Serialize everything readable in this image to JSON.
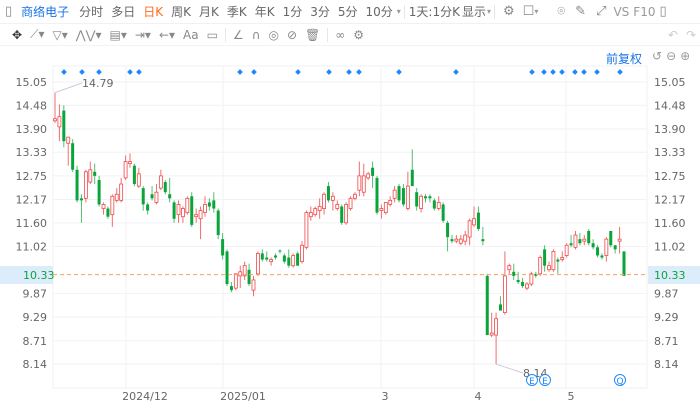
{
  "toolbar": {
    "stock_name": "商络电子",
    "periods": [
      "分时",
      "多日",
      "日K",
      "周K",
      "月K",
      "季K",
      "年K",
      "1分",
      "3分",
      "5分",
      "10分"
    ],
    "active_period": "日K",
    "range_label": "1天:1分K",
    "display_label": "显示",
    "vs_label": "VS",
    "f10_label": "F10",
    "icons": [
      "settings-icon",
      "layout-icon",
      "camera-icon",
      "pencil-icon",
      "fullscreen-icon",
      "panel-icon"
    ]
  },
  "drawing_tools": {
    "text_tool_label": "Aa",
    "icons": [
      "move-icon",
      "line-icon",
      "polygon-icon",
      "wave-icon",
      "fib-icon",
      "measure-icon",
      "arrow-icon",
      "text-icon",
      "comment-icon",
      "angle-icon",
      "magnet-icon",
      "eye-icon",
      "hide-icon",
      "trash-icon",
      "link-icon",
      "settings-icon",
      "undo-icon",
      "redo-icon"
    ]
  },
  "chart_header": {
    "adjust_label": "前复权",
    "icons": [
      "reset-icon",
      "zoom-out-icon",
      "zoom-in-icon"
    ]
  },
  "chart_data": {
    "type": "candlestick",
    "y_ticks": [
      "15.05",
      "14.48",
      "13.90",
      "13.33",
      "12.75",
      "12.17",
      "11.60",
      "11.02",
      "9.87",
      "9.29",
      "8.71",
      "8.14"
    ],
    "ylim": [
      7.6,
      15.4
    ],
    "x_ticks": [
      "2024/12",
      "2025/01",
      "3",
      "4",
      "5"
    ],
    "current_price": "10.33",
    "high_label": "14.79",
    "low_label": "8.14",
    "colors": {
      "up": "#f0494a",
      "down": "#0aa53a",
      "current": "#f6a05c",
      "marker": "#1e88ff"
    },
    "ohlc": [
      [
        14.1,
        14.79,
        14.05,
        14.15
      ],
      [
        13.95,
        14.5,
        13.6,
        14.2
      ],
      [
        14.35,
        14.48,
        13.45,
        13.6
      ],
      [
        13.55,
        13.7,
        13.0,
        13.7
      ],
      [
        13.55,
        13.65,
        12.85,
        12.9
      ],
      [
        12.9,
        13.0,
        12.1,
        12.15
      ],
      [
        12.2,
        12.3,
        11.6,
        12.15
      ],
      [
        12.2,
        12.9,
        12.1,
        12.85
      ],
      [
        12.6,
        13.1,
        12.55,
        12.9
      ],
      [
        12.85,
        13.05,
        12.55,
        12.75
      ],
      [
        12.65,
        12.75,
        12.0,
        12.05
      ],
      [
        11.95,
        12.1,
        11.8,
        12.05
      ],
      [
        11.95,
        12.0,
        11.7,
        11.75
      ],
      [
        11.8,
        12.3,
        11.5,
        12.25
      ],
      [
        12.15,
        12.45,
        12.1,
        12.3
      ],
      [
        12.15,
        12.7,
        12.1,
        12.55
      ],
      [
        12.7,
        13.25,
        12.65,
        13.1
      ],
      [
        13.05,
        13.3,
        12.95,
        13.1
      ],
      [
        13.0,
        13.05,
        12.5,
        12.55
      ],
      [
        12.5,
        12.95,
        12.45,
        12.8
      ],
      [
        12.45,
        12.5,
        11.9,
        12.05
      ],
      [
        12.05,
        12.1,
        11.8,
        11.9
      ],
      [
        12.3,
        12.5,
        12.15,
        12.2
      ],
      [
        12.1,
        12.55,
        12.05,
        12.35
      ],
      [
        12.45,
        12.9,
        12.4,
        12.75
      ],
      [
        12.6,
        12.65,
        12.3,
        12.35
      ],
      [
        12.3,
        12.7,
        12.1,
        12.2
      ],
      [
        12.1,
        12.15,
        11.6,
        11.7
      ],
      [
        11.8,
        12.15,
        11.6,
        12.05
      ],
      [
        11.75,
        12.0,
        11.6,
        11.95
      ],
      [
        11.85,
        12.25,
        11.8,
        12.2
      ],
      [
        12.25,
        12.35,
        11.5,
        11.55
      ],
      [
        11.75,
        11.95,
        11.6,
        11.8
      ],
      [
        11.7,
        12.0,
        11.2,
        11.9
      ],
      [
        11.85,
        12.25,
        11.75,
        12.05
      ],
      [
        12.1,
        12.2,
        11.9,
        12.0
      ],
      [
        12.15,
        12.35,
        11.85,
        11.95
      ],
      [
        11.9,
        11.95,
        11.2,
        11.3
      ],
      [
        11.2,
        11.35,
        10.7,
        10.8
      ],
      [
        10.9,
        10.95,
        10.05,
        10.1
      ],
      [
        10.05,
        10.15,
        9.9,
        9.95
      ],
      [
        10.0,
        10.35,
        9.95,
        10.35
      ],
      [
        10.3,
        10.55,
        10.0,
        10.4
      ],
      [
        10.3,
        10.65,
        10.2,
        10.55
      ],
      [
        10.45,
        10.6,
        10.05,
        10.1
      ],
      [
        9.95,
        10.3,
        9.8,
        10.2
      ],
      [
        10.35,
        10.9,
        10.3,
        10.85
      ],
      [
        10.85,
        10.95,
        10.65,
        10.7
      ],
      [
        10.75,
        10.9,
        10.65,
        10.7
      ],
      [
        10.65,
        10.75,
        10.55,
        10.7
      ],
      [
        10.8,
        10.85,
        10.7,
        10.75
      ],
      [
        10.92,
        10.95,
        10.85,
        10.9
      ],
      [
        10.8,
        10.85,
        10.6,
        10.65
      ],
      [
        10.75,
        10.95,
        10.5,
        10.55
      ],
      [
        10.55,
        10.85,
        10.5,
        10.8
      ],
      [
        10.85,
        10.9,
        10.55,
        10.55
      ],
      [
        10.65,
        11.15,
        10.6,
        11.05
      ],
      [
        11.0,
        11.9,
        10.95,
        11.85
      ],
      [
        11.75,
        12.0,
        11.65,
        11.85
      ],
      [
        11.8,
        12.0,
        11.75,
        11.95
      ],
      [
        11.9,
        12.2,
        11.7,
        12.0
      ],
      [
        11.95,
        12.35,
        11.8,
        12.3
      ],
      [
        12.5,
        12.6,
        12.1,
        12.15
      ],
      [
        12.15,
        12.35,
        11.9,
        12.25
      ],
      [
        11.95,
        12.15,
        11.9,
        12.05
      ],
      [
        12.0,
        12.05,
        11.55,
        11.6
      ],
      [
        11.6,
        12.1,
        11.55,
        12.05
      ],
      [
        11.95,
        12.25,
        11.9,
        12.2
      ],
      [
        12.2,
        12.35,
        12.15,
        12.3
      ],
      [
        12.4,
        13.1,
        12.25,
        12.75
      ],
      [
        12.35,
        13.05,
        12.25,
        12.75
      ],
      [
        12.7,
        12.85,
        12.65,
        12.8
      ],
      [
        12.95,
        13.1,
        12.45,
        12.75
      ],
      [
        12.7,
        12.75,
        11.8,
        11.85
      ],
      [
        11.9,
        12.05,
        11.7,
        11.95
      ],
      [
        11.85,
        12.1,
        11.8,
        12.1
      ],
      [
        12.05,
        12.25,
        12.0,
        12.15
      ],
      [
        12.2,
        12.5,
        12.1,
        12.4
      ],
      [
        12.5,
        12.55,
        12.1,
        12.15
      ],
      [
        12.45,
        12.55,
        12.0,
        12.05
      ],
      [
        11.95,
        12.85,
        11.9,
        12.5
      ],
      [
        12.9,
        13.4,
        12.5,
        12.5
      ],
      [
        12.35,
        12.45,
        11.9,
        12.0
      ],
      [
        11.95,
        12.3,
        11.85,
        12.25
      ],
      [
        12.25,
        12.3,
        12.1,
        12.2
      ],
      [
        12.25,
        12.3,
        12.1,
        12.2
      ],
      [
        12.15,
        12.2,
        11.9,
        11.95
      ],
      [
        11.95,
        12.25,
        11.9,
        12.1
      ],
      [
        12.05,
        12.1,
        11.6,
        11.65
      ],
      [
        11.6,
        11.65,
        10.9,
        11.25
      ],
      [
        11.2,
        11.3,
        11.1,
        11.15
      ],
      [
        11.15,
        11.3,
        11.1,
        11.2
      ],
      [
        11.1,
        11.3,
        11.05,
        11.2
      ],
      [
        11.15,
        11.4,
        11.05,
        11.3
      ],
      [
        11.25,
        11.7,
        11.05,
        11.65
      ],
      [
        11.55,
        12.0,
        11.5,
        11.7
      ],
      [
        11.85,
        12.0,
        11.4,
        11.45
      ],
      [
        11.2,
        11.5,
        11.05,
        11.15
      ],
      [
        10.3,
        10.35,
        8.85,
        8.85
      ],
      [
        8.85,
        9.4,
        8.8,
        8.9
      ],
      [
        8.85,
        9.4,
        8.14,
        9.25
      ],
      [
        9.6,
        9.8,
        9.45,
        9.45
      ],
      [
        9.4,
        10.9,
        9.35,
        10.3
      ],
      [
        10.45,
        10.6,
        10.35,
        10.55
      ],
      [
        10.4,
        10.6,
        10.2,
        10.3
      ],
      [
        10.2,
        10.4,
        10.1,
        10.15
      ],
      [
        10.15,
        10.25,
        10.0,
        10.05
      ],
      [
        10.0,
        10.15,
        9.95,
        10.1
      ],
      [
        10.1,
        10.4,
        10.05,
        10.35
      ],
      [
        10.35,
        10.4,
        10.25,
        10.3
      ],
      [
        10.35,
        10.8,
        10.3,
        10.75
      ],
      [
        10.95,
        11.05,
        10.4,
        10.55
      ],
      [
        10.45,
        10.65,
        10.4,
        10.55
      ],
      [
        10.45,
        10.95,
        10.4,
        10.9
      ],
      [
        10.7,
        10.75,
        10.35,
        10.65
      ],
      [
        10.7,
        10.9,
        10.65,
        10.75
      ],
      [
        10.8,
        11.1,
        10.75,
        11.05
      ],
      [
        11.1,
        11.3,
        11.0,
        11.05
      ],
      [
        11.0,
        11.4,
        10.95,
        11.3
      ],
      [
        11.2,
        11.35,
        11.05,
        11.1
      ],
      [
        11.15,
        11.3,
        11.05,
        11.2
      ],
      [
        11.4,
        11.45,
        11.05,
        11.1
      ],
      [
        11.1,
        11.2,
        10.95,
        11.0
      ],
      [
        11.0,
        11.05,
        10.75,
        10.8
      ],
      [
        10.8,
        10.85,
        10.7,
        10.75
      ],
      [
        10.8,
        11.25,
        10.65,
        11.2
      ],
      [
        11.4,
        11.4,
        11.0,
        11.05
      ],
      [
        11.05,
        11.05,
        10.85,
        10.95
      ],
      [
        11.15,
        11.5,
        10.85,
        11.2
      ],
      [
        10.9,
        10.9,
        10.3,
        10.3
      ]
    ],
    "event_markers": [
      "E",
      "E",
      "Q"
    ]
  }
}
